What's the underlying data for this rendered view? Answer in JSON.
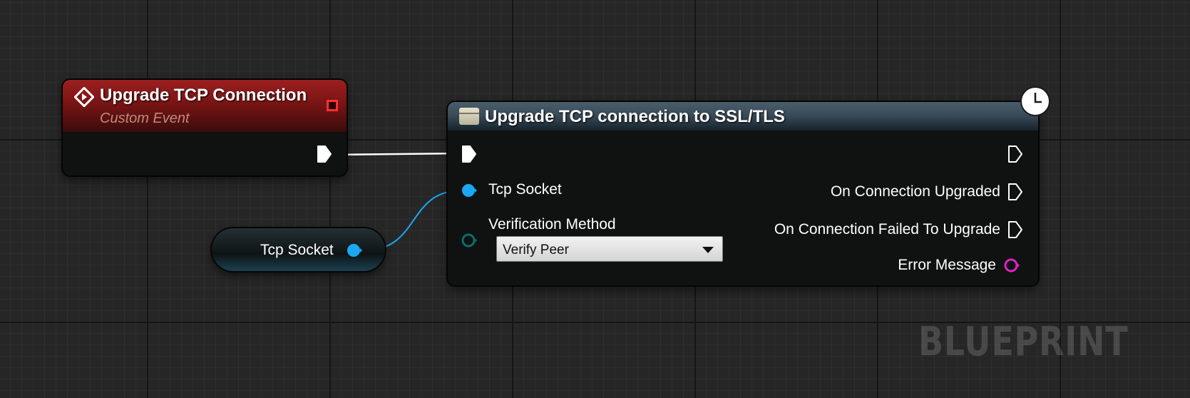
{
  "event_node": {
    "title": "Upgrade TCP Connection",
    "subtitle": "Custom Event",
    "icon": "custom-event-icon",
    "header_color": "#8e1b1b"
  },
  "getter_node": {
    "label": "Tcp Socket",
    "pin_color": "#1aa8f2"
  },
  "function_node": {
    "title": "Upgrade TCP connection to SSL/TLS",
    "icon": "function-icon",
    "latent_icon": "clock-icon",
    "inputs": {
      "tcp_socket_label": "Tcp Socket",
      "verification_label": "Verification Method",
      "verification_value": "Verify Peer"
    },
    "outputs": {
      "upgraded_label": "On Connection Upgraded",
      "failed_label": "On Connection Failed To Upgrade",
      "error_label": "Error Message"
    },
    "colors": {
      "object_pin": "#1aa8f2",
      "enum_pin": "#0e6b6b",
      "string_pin": "#e020c8",
      "header": "#3f5260"
    }
  },
  "watermark": "BLUEPRINT"
}
